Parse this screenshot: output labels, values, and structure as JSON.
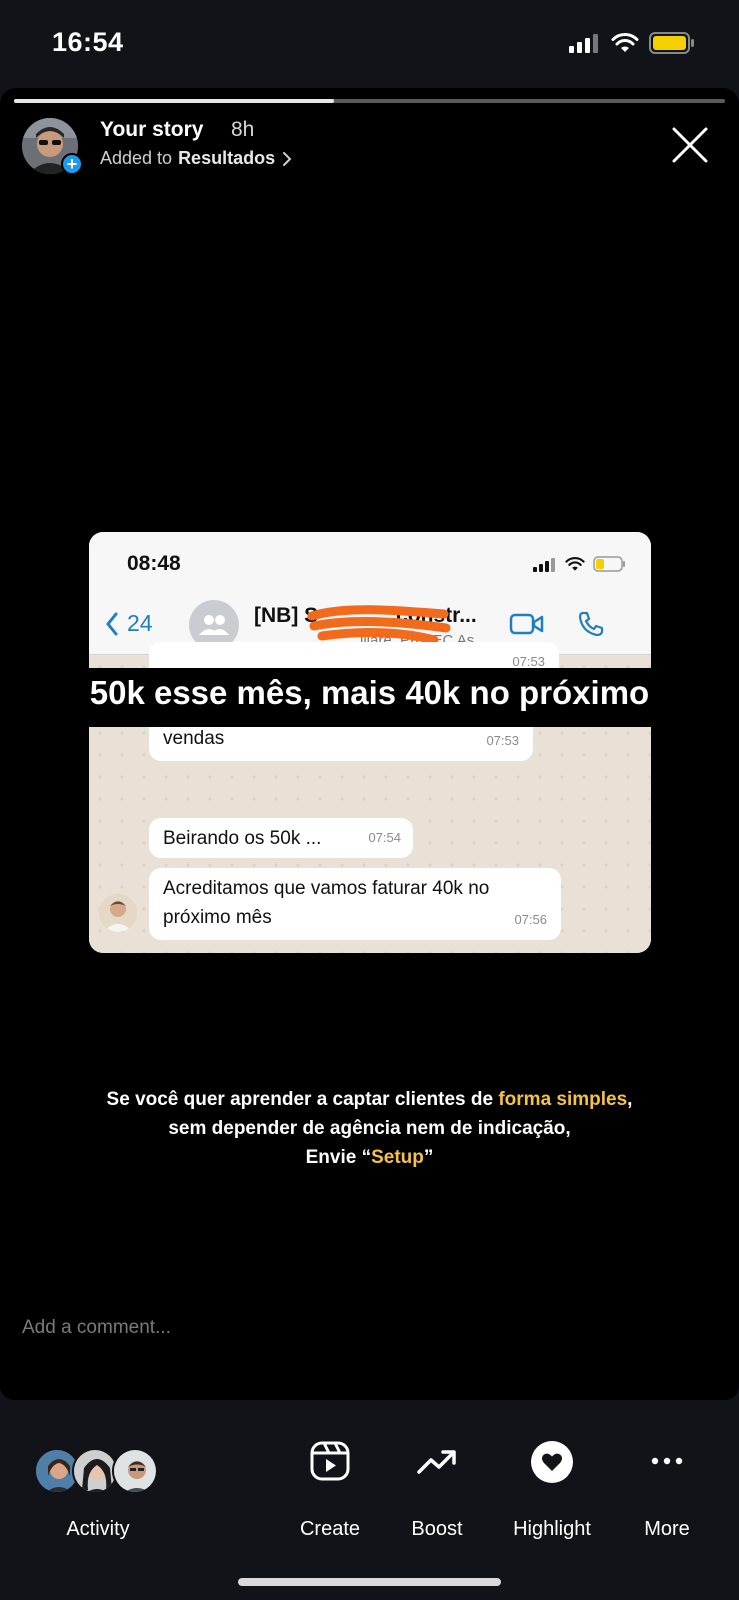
{
  "status_bar": {
    "time": "16:54"
  },
  "story": {
    "progress": 0.45,
    "user": "Your story",
    "time_ago": "8h",
    "added_prefix": "Added to",
    "highlight_name": "Resultados"
  },
  "chat": {
    "time": "08:48",
    "back_count": "24",
    "group_name": "[NB] S",
    "group_name_end": "constr...",
    "group_subtitle": "iliare, PROEC As...",
    "messages": [
      {
        "text": "",
        "time": "07:53"
      },
      {
        "text": "Essa semana foram 4 reuniões e 3 vendas",
        "time": "07:53"
      },
      {
        "text": "Beirando os 50k ...",
        "time": "07:54"
      },
      {
        "text": "Acreditamos que vamos faturar 40k no próximo mês",
        "time": "07:56"
      }
    ]
  },
  "overlay_text": "50k esse mês, mais 40k no próximo",
  "caption": {
    "line1_a": "Se você quer aprender a captar clientes de ",
    "line1_hl": "forma simples",
    "line1_b": ",",
    "line2": "sem depender de agência nem de indicação,",
    "line3_a": "Envie “",
    "line3_hl": "Setup",
    "line3_b": "”"
  },
  "comment_placeholder": "Add a comment...",
  "bottom_tabs": {
    "activity": "Activity",
    "create": "Create",
    "boost": "Boost",
    "highlight": "Highlight",
    "more": "More"
  },
  "colors": {
    "accent_yellow": "#f5c242",
    "badge_blue": "#1d9bf0",
    "whatsapp_blue": "#1f7fbf",
    "redaction_orange": "#f26b1d"
  }
}
